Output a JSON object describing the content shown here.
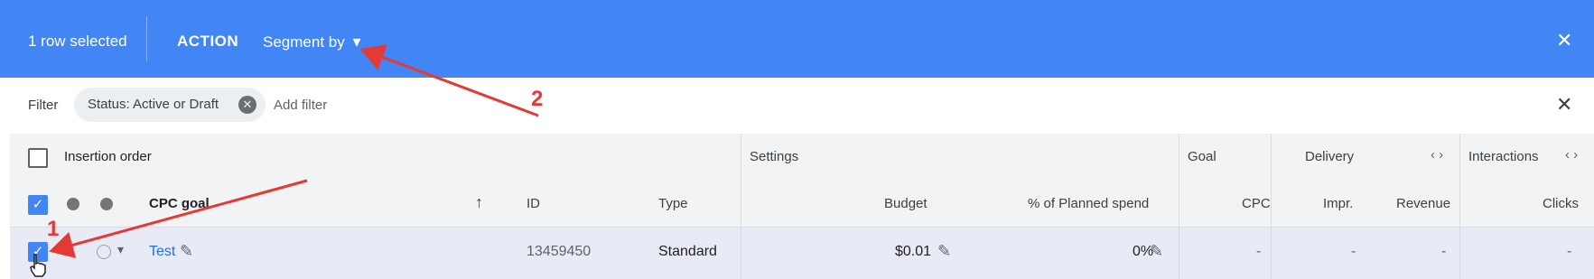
{
  "selection_bar": {
    "count_text": "1 row selected",
    "action_label": "ACTION",
    "segment_label": "Segment by",
    "dropdown_glyph": "▾",
    "close_glyph": "✕",
    "background": "#4285f4"
  },
  "filter_bar": {
    "label": "Filter",
    "chip_text": "Status: Active or Draft",
    "chip_remove_glyph": "✕",
    "add_filter_placeholder": "Add filter",
    "close_glyph": "✕"
  },
  "table": {
    "group_headers": {
      "insertion_order": "Insertion order",
      "settings": "Settings",
      "goal": "Goal",
      "delivery": "Delivery",
      "interactions": "Interactions",
      "expand_glyph": "‹ ›"
    },
    "column_headers": {
      "cpc_goal": "CPC goal",
      "sort_glyph": "↑",
      "id": "ID",
      "type": "Type",
      "budget": "Budget",
      "planned_spend": "% of Planned spend",
      "cpc": "CPC",
      "impr": "Impr.",
      "revenue": "Revenue",
      "clicks": "Clicks"
    },
    "rows": [
      {
        "name": "Test",
        "id": "13459450",
        "type": "Standard",
        "budget": "$0.01",
        "planned_spend": "0%",
        "cpc": "-",
        "impr": "-",
        "revenue": "-",
        "clicks": "-",
        "selected": true
      }
    ]
  },
  "annotations": {
    "label_1": "1",
    "label_2": "2",
    "color": "#e53935"
  }
}
